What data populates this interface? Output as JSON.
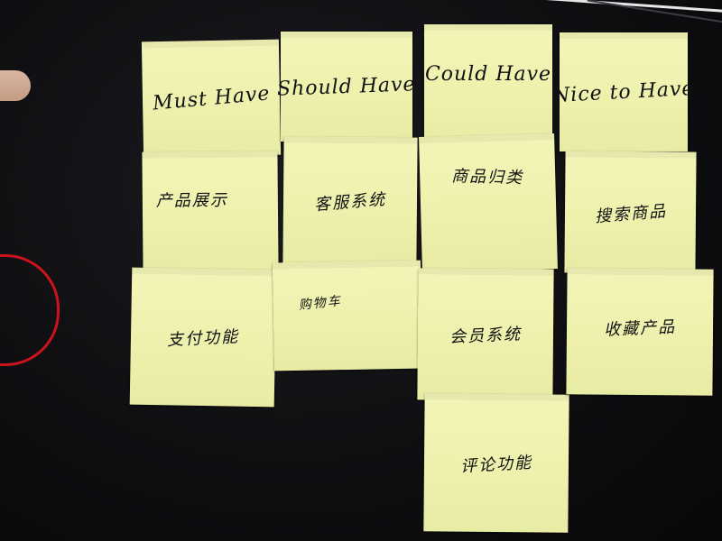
{
  "headers": {
    "must_have": "Must Have",
    "should_have": "Should Have",
    "could_have": "Could Have",
    "nice_to_have": "Nice to Have"
  },
  "must_have_items": [
    "产品展示",
    "支付功能"
  ],
  "should_have_items": [
    "客服系统",
    "购物车"
  ],
  "could_have_items": [
    "商品归类",
    "会员系统",
    "评论功能"
  ],
  "nice_to_have_items": [
    "搜索商品",
    "收藏产品"
  ],
  "colors": {
    "note": "#f0f2b0",
    "background": "#0e0e11",
    "cable": "#c8141a"
  }
}
